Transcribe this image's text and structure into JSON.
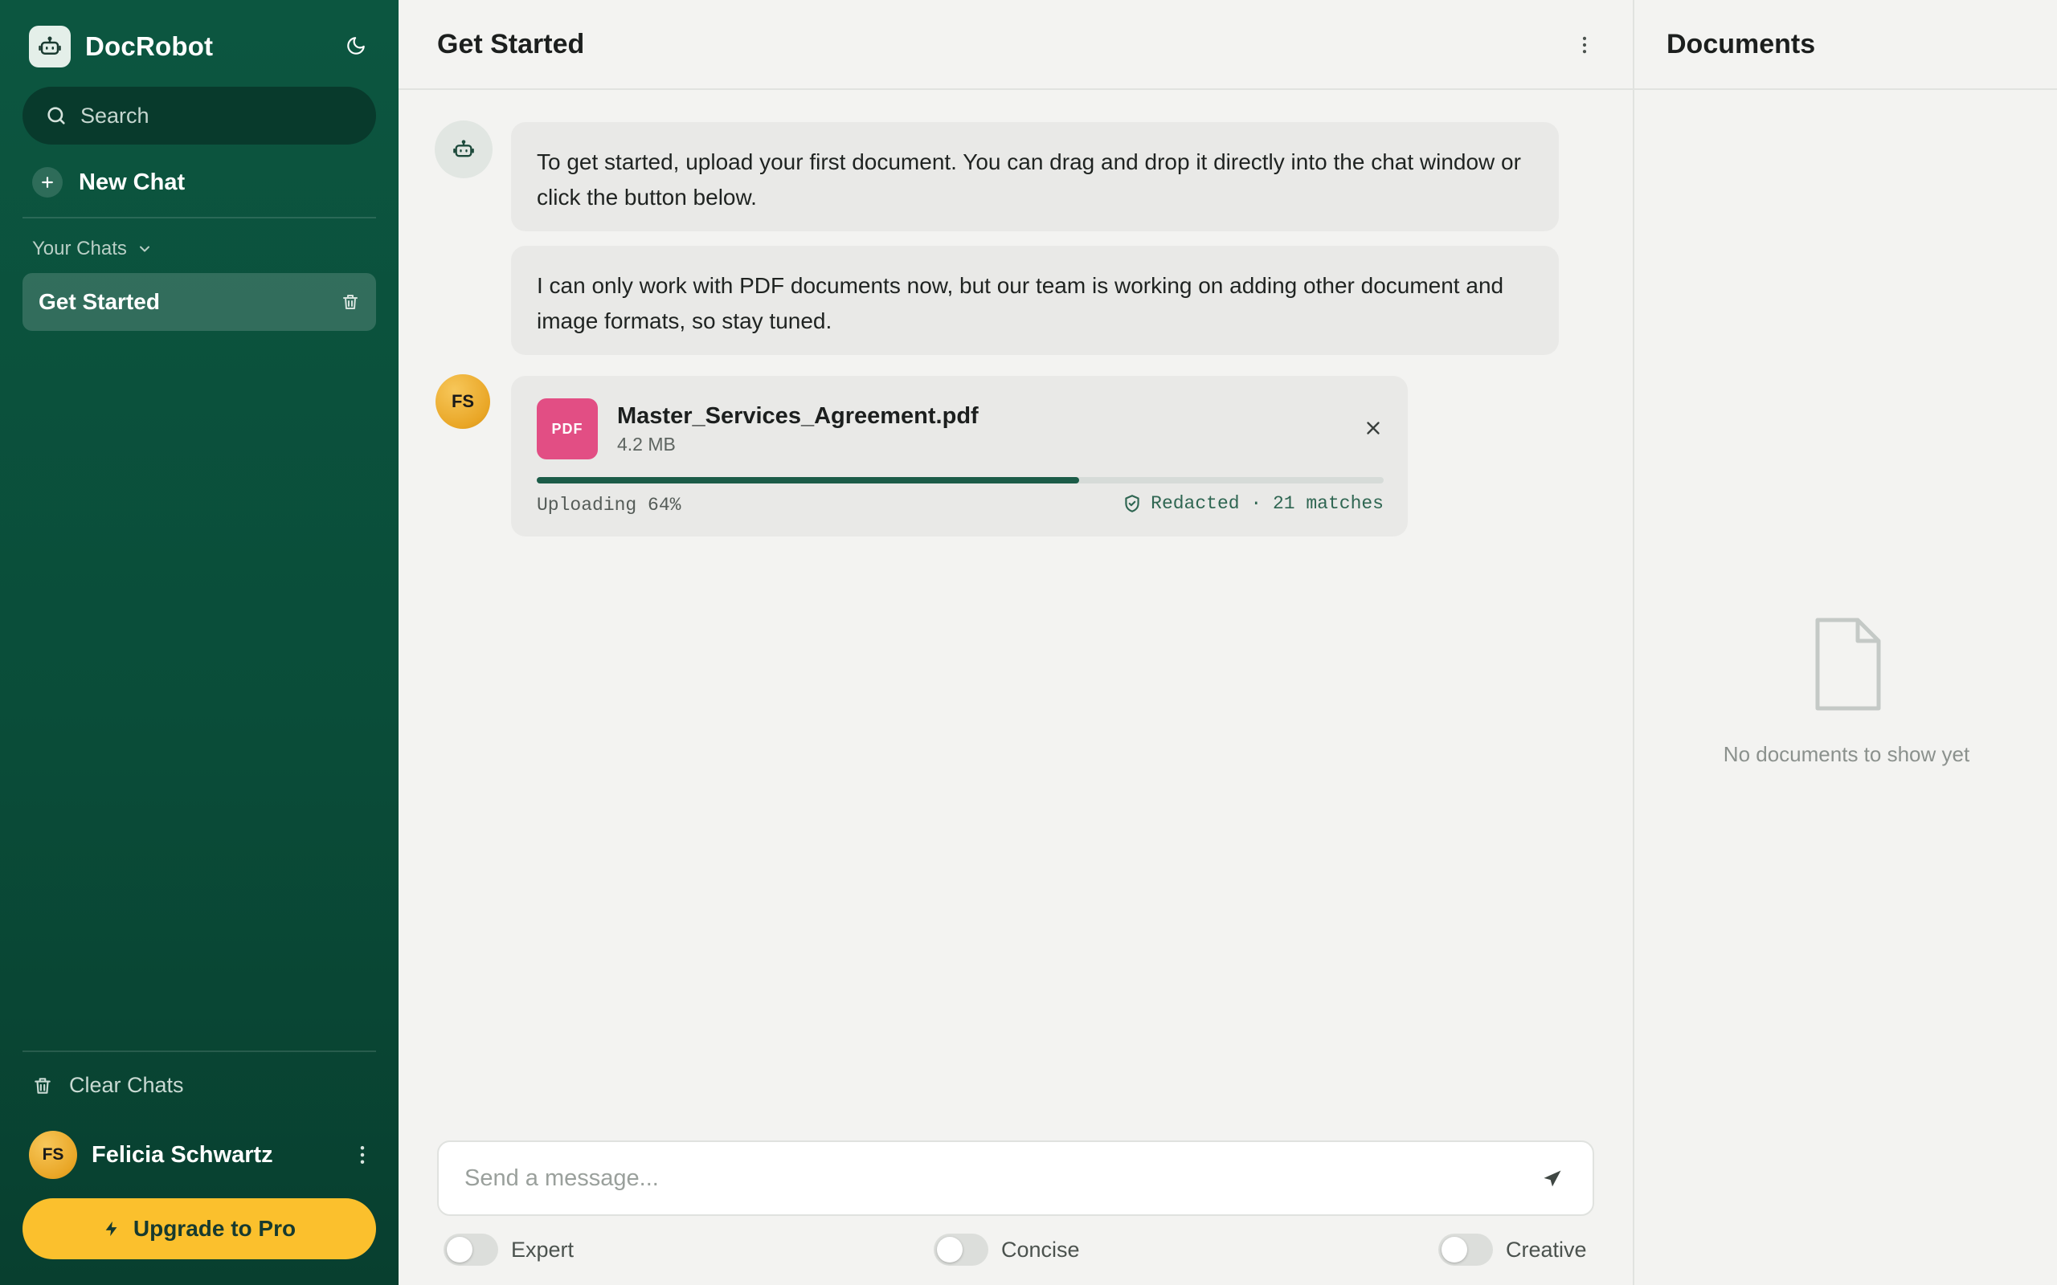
{
  "app": {
    "name": "DocRobot",
    "brand_color": "#0c5640",
    "accent_color": "#fbc02d"
  },
  "sidebar": {
    "search": {
      "placeholder": "Search"
    },
    "new_chat_label": "New Chat",
    "section_label": "Your Chats",
    "chats": [
      {
        "label": "Get Started",
        "active": true
      }
    ],
    "clear_chats_label": "Clear Chats",
    "user": {
      "initials": "FS",
      "name": "Felicia Schwartz"
    },
    "upgrade_label": "Upgrade to Pro"
  },
  "main": {
    "title": "Get Started",
    "messages": [
      {
        "role": "bot",
        "text": "To get started, upload your first document. You can drag and drop it directly into the chat window or click the button below."
      },
      {
        "role": "bot",
        "text": "I can only work with PDF documents now, but our team is working on adding other document and image formats, so stay tuned."
      }
    ],
    "upload": {
      "badge": "PDF",
      "badge_color": "#e24e84",
      "file_name": "Master_Services_Agreement.pdf",
      "file_size": "4.2 MB",
      "progress_percent": 64,
      "status": "Uploading 64%",
      "redaction": "Redacted · 21 matches"
    },
    "composer": {
      "placeholder": "Send a message...",
      "value": ""
    },
    "toggles": [
      {
        "label": "Expert",
        "on": false
      },
      {
        "label": "Concise",
        "on": false
      },
      {
        "label": "Creative",
        "on": false
      }
    ]
  },
  "documents": {
    "title": "Documents",
    "empty_text": "No documents to show yet"
  },
  "icons": {
    "brand": "robot-icon",
    "theme": "moon-icon",
    "search": "search-icon",
    "new_chat": "plus-icon",
    "section": "chevron-down-icon",
    "delete_chat": "trash-icon",
    "clear": "trash-icon",
    "user_menu": "kebab-icon",
    "upgrade": "bolt-icon",
    "header_menu": "kebab-icon",
    "close": "close-icon",
    "redacted": "shield-check-icon",
    "send": "send-icon",
    "empty_docs": "document-icon"
  }
}
